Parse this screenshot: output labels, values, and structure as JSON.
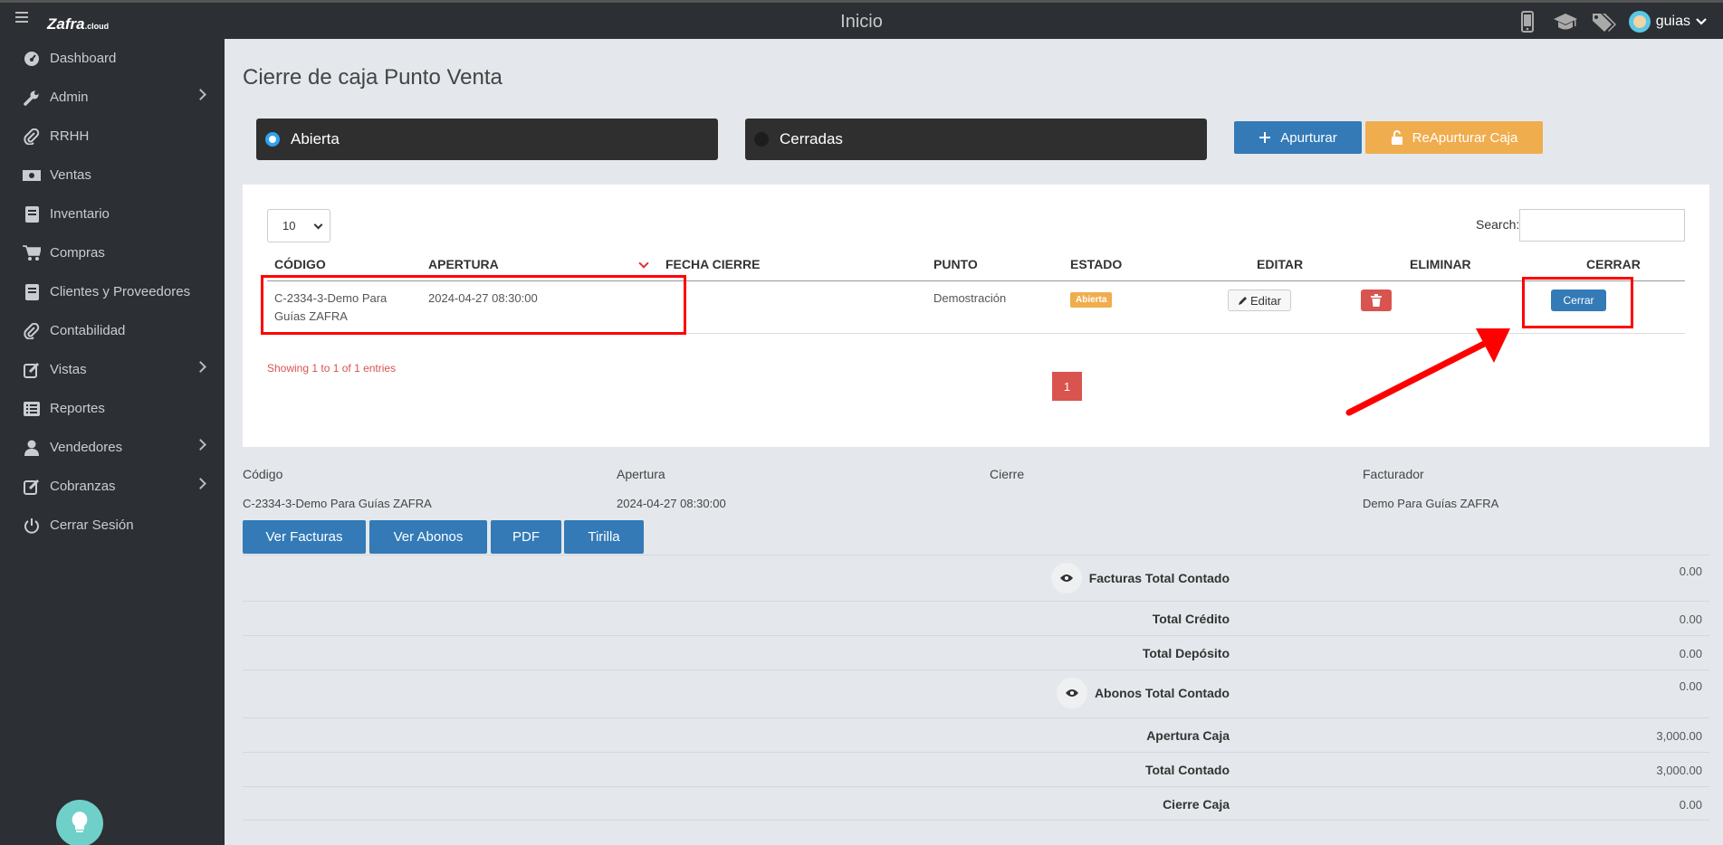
{
  "header": {
    "logo": "Zafra",
    "logo_suffix": ".cloud",
    "title": "Inicio",
    "user": "guias",
    "icons": [
      "mobile-icon",
      "graduation-cap-icon",
      "tags-icon"
    ]
  },
  "sidebar": {
    "items": [
      {
        "label": "Dashboard",
        "icon": "dashboard-icon",
        "submenu": false
      },
      {
        "label": "Admin",
        "icon": "wrench-icon",
        "submenu": true
      },
      {
        "label": "RRHH",
        "icon": "paperclip-icon",
        "submenu": false
      },
      {
        "label": "Ventas",
        "icon": "money-icon",
        "submenu": false
      },
      {
        "label": "Inventario",
        "icon": "book-icon",
        "submenu": false
      },
      {
        "label": "Compras",
        "icon": "cart-icon",
        "submenu": false
      },
      {
        "label": "Clientes y Proveedores",
        "icon": "book-icon",
        "submenu": false
      },
      {
        "label": "Contabilidad",
        "icon": "paperclip-icon",
        "submenu": false
      },
      {
        "label": "Vistas",
        "icon": "edit-icon",
        "submenu": true
      },
      {
        "label": "Reportes",
        "icon": "list-icon",
        "submenu": false
      },
      {
        "label": "Vendedores",
        "icon": "user-icon",
        "submenu": true
      },
      {
        "label": "Cobranzas",
        "icon": "edit-icon",
        "submenu": true
      },
      {
        "label": "Cerrar Sesión",
        "icon": "power-icon",
        "submenu": false
      }
    ]
  },
  "page": {
    "title": "Cierre de caja Punto Venta",
    "filters": {
      "open": "Abierta",
      "closed": "Cerradas"
    },
    "buttons": {
      "open": "Apurturar",
      "reopen": "ReApurturar Caja"
    }
  },
  "table": {
    "length_value": "10",
    "search_label": "Search:",
    "search_value": "",
    "columns": [
      "CÓDIGO",
      "APERTURA",
      "FECHA CIERRE",
      "PUNTO",
      "ESTADO",
      "EDITAR",
      "ELIMINAR",
      "CERRAR"
    ],
    "rows": [
      {
        "codigo_line1": "C-2334-3-Demo Para",
        "codigo_line2": "Guías ZAFRA",
        "apertura": "2024-04-27 08:30:00",
        "fecha_cierre": "",
        "punto": "Demostración",
        "estado": "Abierta",
        "editar": "Editar",
        "cerrar": "Cerrar"
      }
    ],
    "showing": "Showing 1 to 1 of 1 entries",
    "page": "1"
  },
  "details": {
    "labels": {
      "codigo": "Código",
      "apertura": "Apertura",
      "cierre": "Cierre",
      "facturador": "Facturador"
    },
    "values": {
      "codigo": "C-2334-3-Demo Para Guías ZAFRA",
      "apertura": "2024-04-27 08:30:00",
      "cierre": "",
      "facturador": "Demo Para Guías ZAFRA"
    },
    "buttons": {
      "ver_facturas": "Ver Facturas",
      "ver_abonos": "Ver Abonos",
      "pdf": "PDF",
      "tirilla": "Tirilla"
    }
  },
  "totals": [
    {
      "label": "Facturas Total Contado",
      "value": "0.00",
      "eye": true
    },
    {
      "label": "Total Crédito",
      "value": "0.00",
      "eye": false
    },
    {
      "label": "Total Depósito",
      "value": "0.00",
      "eye": false
    },
    {
      "label": "Abonos Total Contado",
      "value": "0.00",
      "eye": true
    },
    {
      "label": "Apertura Caja",
      "value": "3,000.00",
      "eye": false
    },
    {
      "label": "Total Contado",
      "value": "3,000.00",
      "eye": false
    },
    {
      "label": "Cierre Caja",
      "value": "0.00",
      "eye": false
    }
  ],
  "colors": {
    "accent_blue": "#337ab7",
    "warning": "#f0ad4e",
    "danger": "#d9534f",
    "highlight": "#ff0000"
  }
}
